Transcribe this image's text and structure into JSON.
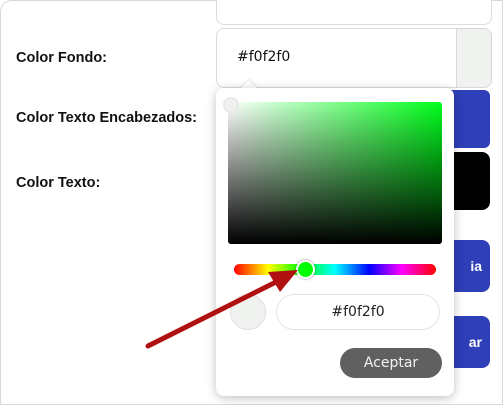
{
  "form": {
    "labels": {
      "background_color": "Color Fondo:",
      "heading_text_color": "Color Texto Encabezados:",
      "text_color": "Color Texto:"
    },
    "background_color_value": "#f0f2f0",
    "right_button_1": "ia",
    "right_button_2": "ar"
  },
  "picker": {
    "hex_value": "#f0f2f0",
    "accept_label": "Aceptar",
    "hue_color": "#00ff00",
    "selected_color": "#f0f2f0"
  },
  "colors": {
    "accent_blue": "#2e3fb8",
    "annotation_arrow": "#b01010"
  },
  "annotation": {
    "icon": "arrow-icon",
    "points_to": "hue-slider"
  }
}
